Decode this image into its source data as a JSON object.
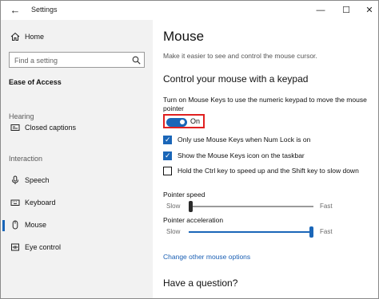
{
  "titlebar": {
    "title": "Settings",
    "back_icon": "back-arrow-icon",
    "minimize_icon": "minimize-icon",
    "maximize_icon": "maximize-icon",
    "close_icon": "close-icon"
  },
  "sidebar": {
    "home_label": "Home",
    "search_placeholder": "Find a setting",
    "section_title": "Ease of Access",
    "groups": {
      "hearing": "Hearing",
      "interaction": "Interaction"
    },
    "items": {
      "closed_captions": "Closed captions",
      "speech": "Speech",
      "keyboard": "Keyboard",
      "mouse": "Mouse",
      "eye_control": "Eye control"
    },
    "active_item": "Mouse"
  },
  "main": {
    "title": "Mouse",
    "subtitle": "Make it easier to see and control the mouse cursor.",
    "section_title": "Control your mouse with a keypad",
    "description": "Turn on Mouse Keys to use the numeric keypad to move the mouse pointer",
    "toggle": {
      "state_label": "On",
      "on": true
    },
    "checkboxes": [
      {
        "label": "Only use Mouse Keys when Num Lock is on",
        "checked": true
      },
      {
        "label": "Show the Mouse Keys icon on the taskbar",
        "checked": true
      },
      {
        "label": "Hold the Ctrl key to speed up and the Shift key to slow down",
        "checked": false
      }
    ],
    "pointer_speed": {
      "title": "Pointer speed",
      "min_label": "Slow",
      "max_label": "Fast",
      "level": 0.0
    },
    "pointer_acceleration": {
      "title": "Pointer acceleration",
      "min_label": "Slow",
      "max_label": "Fast",
      "level": 1.0
    },
    "link_text": "Change other mouse options",
    "question": "Have a question?"
  },
  "colors": {
    "accent": "#1a66b8",
    "highlight_border": "#e02020",
    "sidebar_bg": "#f2f2f2"
  }
}
